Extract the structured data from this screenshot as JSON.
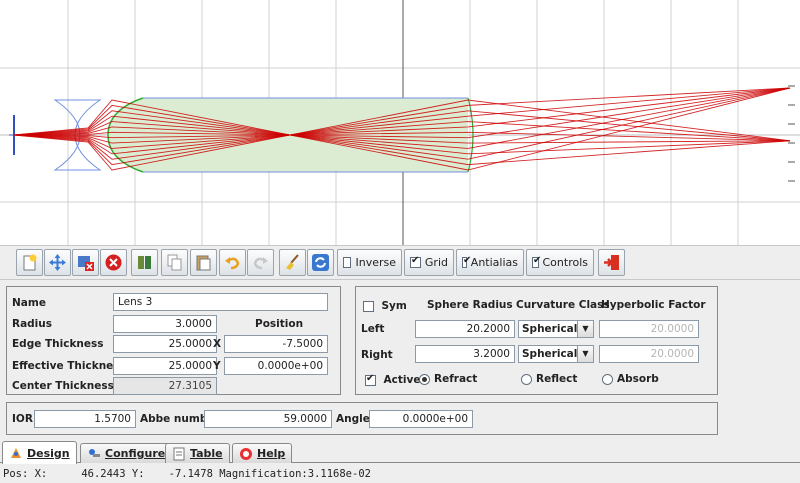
{
  "toolbar": {
    "inverse_label": "Inverse",
    "grid_label": "Grid",
    "antialias_label": "Antialias",
    "controls_label": "Controls",
    "inverse_checked": false,
    "grid_checked": true,
    "antialias_checked": true,
    "controls_checked": true
  },
  "lens_panel": {
    "name_label": "Name",
    "name_value": "Lens 3",
    "radius_label": "Radius",
    "radius_value": "3.0000",
    "position_label": "Position",
    "edge_thickness_label": "Edge Thickness",
    "edge_thickness_value": "25.0000",
    "x_label": "X",
    "x_value": "-7.5000",
    "effective_thickness_label": "Effective Thickness",
    "effective_thickness_value": "25.0000",
    "y_label": "Y",
    "y_value": "0.0000e+00",
    "center_thickness_label": "Center Thickness",
    "center_thickness_value": "27.3105"
  },
  "surface_panel": {
    "sym_label": "Sym",
    "sym_checked": false,
    "sphere_radius_header": "Sphere Radius",
    "curvature_class_header": "Curvature Class",
    "hyperbolic_factor_header": "Hyperbolic Factor",
    "left_label": "Left",
    "left_radius": "20.2000",
    "left_curvature": "Spherical",
    "left_hyperbolic": "20.0000",
    "right_label": "Right",
    "right_radius": "3.2000",
    "right_curvature": "Spherical",
    "right_hyperbolic": "20.0000",
    "active_label": "Active",
    "active_checked": true,
    "refract_label": "Refract",
    "reflect_label": "Reflect",
    "absorb_label": "Absorb",
    "selected_mode": "Refract"
  },
  "material_panel": {
    "ior_label": "IOR",
    "ior_value": "1.5700",
    "abbe_label": "Abbe number",
    "abbe_value": "59.0000",
    "angle_label": "Angle",
    "angle_value": "0.0000e+00"
  },
  "tabs": {
    "design": "Design",
    "configure": "Configure",
    "table": "Table",
    "help": "Help",
    "active": "Design"
  },
  "status": {
    "pos_label": "Pos: X:",
    "x": "46.2443",
    "y_label": "Y:",
    "y": "-7.1478",
    "magnification_label": "Magnification:",
    "magnification": "3.1168e-02"
  },
  "colors": {
    "ray": "#cc0000",
    "lens_fill": "#dcecd2",
    "lens_outline": "#7090e0",
    "curved_surface": "#33aa33",
    "grid": "#d0d0d0",
    "axis": "#555555"
  }
}
